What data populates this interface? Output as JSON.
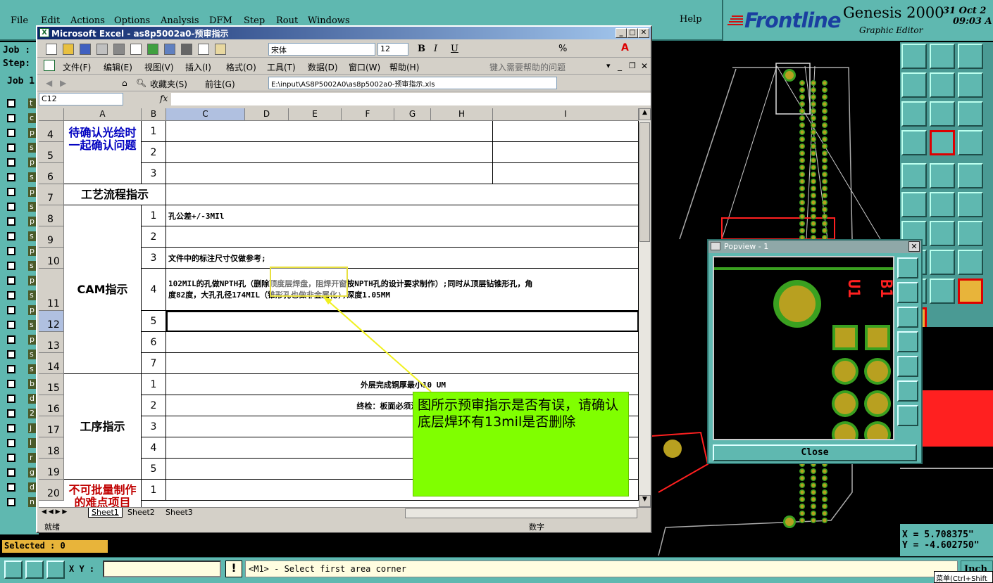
{
  "genesis": {
    "menu": [
      "File",
      "Edit",
      "Actions",
      "Options",
      "Analysis",
      "DFM",
      "Step",
      "Rout",
      "Windows"
    ],
    "help": "Help",
    "logo": "Frontline",
    "product": "Genesis 2000",
    "subtitle": "Graphic Editor",
    "date": "31 Oct 2",
    "time": "09:03 A",
    "left_labels": [
      "Job :",
      "Step:",
      "Job 1"
    ],
    "layer_letters": [
      "t",
      "c",
      "p",
      "s",
      "p",
      "s",
      "p",
      "s",
      "p",
      "s",
      "p",
      "s",
      "p",
      "s",
      "p",
      "s",
      "p",
      "s",
      "s",
      "b",
      "d",
      "2",
      "j",
      "l",
      "r",
      "g",
      "d",
      "n"
    ],
    "selected": "Selected : 0",
    "xy_label": "X Y :",
    "xy_value": "",
    "message": "<M1> - Select first area corner",
    "units": "Inch",
    "tooltip": "菜单(Ctrl+Shift",
    "coord_x": "X = 5.708375\"",
    "coord_y": "Y = -4.602750\"",
    "colors": {
      "panel": "#5fb8b0",
      "copper": "#b8a020",
      "pad_green": "#3aa020",
      "red": "#ff2020"
    }
  },
  "popview": {
    "title": "Popview - 1",
    "close_label": "Close",
    "silk_labels": [
      "B1",
      "U1"
    ]
  },
  "excel": {
    "title": "Microsoft Excel - as8p5002a0-预审指示",
    "font_name": "宋体",
    "font_size": "12",
    "menus": [
      "文件(F)",
      "编辑(E)",
      "视图(V)",
      "插入(I)",
      "格式(O)",
      "工具(T)",
      "数据(D)",
      "窗口(W)",
      "帮助(H)"
    ],
    "help_placeholder": "键入需要帮助的问题",
    "nav": {
      "favorites": "收藏夹(S)",
      "goto": "前往(G)",
      "path": "E:\\input\\AS8P5002A0\\as8p5002a0-预审指示.xls"
    },
    "name_box": "C12",
    "fx": "fx",
    "col_headers": [
      "A",
      "B",
      "C",
      "D",
      "E",
      "F",
      "G",
      "H",
      "I"
    ],
    "rows": [
      {
        "num": "4",
        "b": "1",
        "text": ""
      },
      {
        "num": "5",
        "b": "2",
        "text": ""
      },
      {
        "num": "6",
        "b": "3",
        "text": ""
      },
      {
        "num": "7",
        "b": "",
        "text": ""
      },
      {
        "num": "8",
        "b": "1",
        "text": "孔公差+/-3MIl"
      },
      {
        "num": "9",
        "b": "2",
        "text": ""
      },
      {
        "num": "10",
        "b": "3",
        "text": "文件中的标注尺寸仅做参考;"
      },
      {
        "num": "11",
        "b": "4",
        "text": "102MIL的孔做NPTH孔（删除顶度层焊盘，阻焊开窗按NPTH孔的设计要求制作）;同时从顶层钻锥形孔，角",
        "text2": "度82度，大孔孔径174MIL（锥形孔也做非金属化),深度1.05MM"
      },
      {
        "num": "12",
        "b": "5",
        "text": ""
      },
      {
        "num": "13",
        "b": "6",
        "text": ""
      },
      {
        "num": "14",
        "b": "7",
        "text": ""
      },
      {
        "num": "15",
        "b": "1",
        "text": "外层完成铜厚最小10 UM"
      },
      {
        "num": "16",
        "b": "2",
        "text": "终检：板面必须清洁、干净"
      },
      {
        "num": "17",
        "b": "3",
        "text": ""
      },
      {
        "num": "18",
        "b": "4",
        "text": ""
      },
      {
        "num": "19",
        "b": "5",
        "text": ""
      },
      {
        "num": "20",
        "b": "1",
        "text": ""
      }
    ],
    "sections": {
      "confirm": "待确认光绘时一起确认问题",
      "process": "工艺流程指示",
      "cam": "CAM指示",
      "procedure": "工序指示",
      "difficult": "不可批量制作的难点项目"
    },
    "sheet_tabs": [
      "Sheet1",
      "Sheet2",
      "Sheet3"
    ],
    "status_left": "就绪",
    "status_right": "数字"
  },
  "annotation": {
    "callout_text": "图所示预审指示是否有误，请确认 底层焊环有13mil是否删除"
  }
}
